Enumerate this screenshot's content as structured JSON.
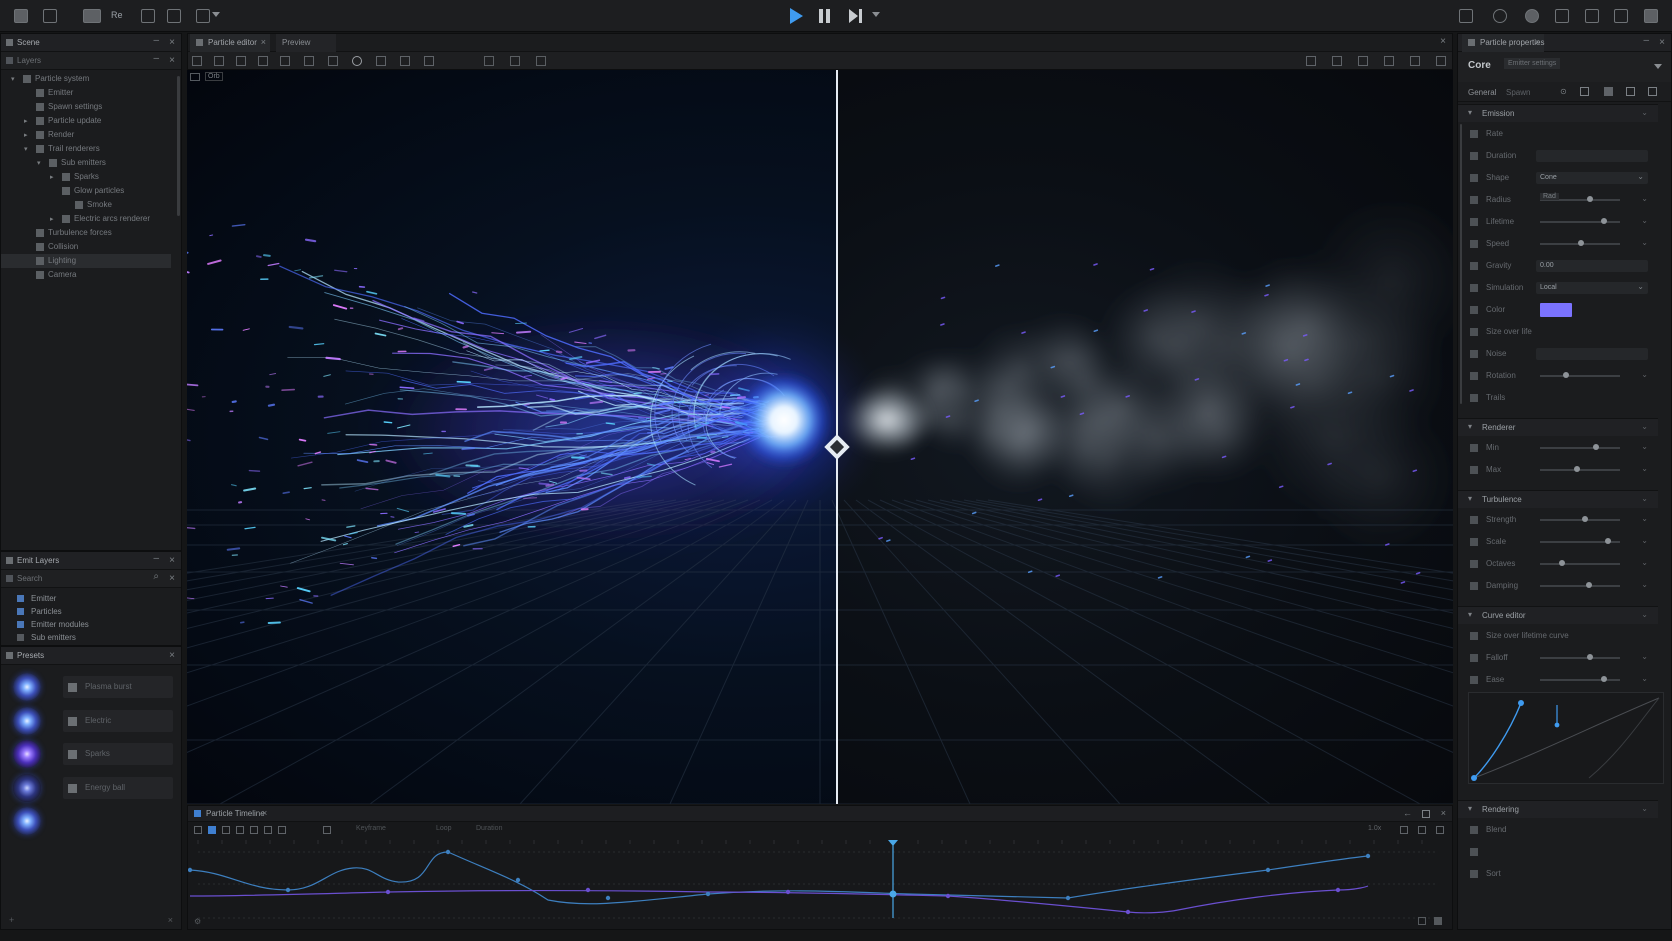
{
  "toolbar": {
    "label": "Re",
    "playback": {
      "play": "play",
      "pause": "pause",
      "step": "step-forward"
    }
  },
  "outliner": {
    "tabs": [
      "Scene",
      ""
    ],
    "filter": "Layers",
    "items": [
      {
        "label": "Particle system",
        "level": 0,
        "expanded": true
      },
      {
        "label": "Emitter",
        "level": 1
      },
      {
        "label": "Spawn settings",
        "level": 1
      },
      {
        "label": "Particle update",
        "level": 1,
        "expanded": false
      },
      {
        "label": "Render",
        "level": 1,
        "expanded": false
      },
      {
        "label": "Trail renderers",
        "level": 1,
        "expanded": true
      },
      {
        "label": "Sub emitters",
        "level": 2,
        "expanded": true
      },
      {
        "label": "Sparks",
        "level": 3,
        "expanded": false
      },
      {
        "label": "Glow particles",
        "level": 3
      },
      {
        "label": "Smoke",
        "level": 4
      },
      {
        "label": "Electric arcs renderer",
        "level": 3,
        "expanded": false
      },
      {
        "label": "Turbulence forces",
        "level": 1
      },
      {
        "label": "Collision",
        "level": 1
      },
      {
        "label": "Lighting",
        "level": 1,
        "selected": true
      },
      {
        "label": "Camera",
        "level": 1
      }
    ]
  },
  "layers": {
    "title": "Emit Layers",
    "filter": "Search",
    "items": [
      "Emitter",
      "Particles",
      "Emitter modules",
      "Sub emitters"
    ]
  },
  "presets": {
    "title": "Presets",
    "items": [
      "Plasma burst",
      "Electric",
      "Sparks",
      "Energy ball",
      ""
    ]
  },
  "viewport": {
    "tabs": [
      "Particle editor",
      "Preview"
    ],
    "overlay_label": "Orb"
  },
  "inspector": {
    "tab": "Particle properties",
    "header": {
      "title": "Core",
      "subtitle": "Emitter settings"
    },
    "subtabs": [
      "General",
      "Spawn"
    ],
    "sections": [
      {
        "title": "Emission",
        "rows": [
          {
            "label": "Rate",
            "kind": "plain"
          },
          {
            "label": "Duration",
            "kind": "field",
            "value": ""
          },
          {
            "label": "Shape",
            "kind": "dropdown",
            "value": "Cone"
          },
          {
            "label": "Radius",
            "kind": "slider",
            "value": "Rad"
          },
          {
            "label": "Lifetime",
            "kind": "slider",
            "value": ""
          },
          {
            "label": "Speed",
            "kind": "slider",
            "value": ""
          },
          {
            "label": "Gravity",
            "kind": "field",
            "value": "0.00"
          },
          {
            "label": "Simulation",
            "kind": "dropdown",
            "value": "Local"
          },
          {
            "label": "Color",
            "kind": "color",
            "value": "#7b73ff"
          },
          {
            "label": "Size over life",
            "kind": "plain"
          },
          {
            "label": "Noise",
            "kind": "field",
            "value": ""
          },
          {
            "label": "Rotation",
            "kind": "slider",
            "value": ""
          },
          {
            "label": "Trails",
            "kind": "plain"
          }
        ]
      },
      {
        "title": "Renderer",
        "rows": [
          {
            "label": "Min",
            "kind": "slider"
          },
          {
            "label": "Max",
            "kind": "slider"
          }
        ]
      },
      {
        "title": "Turbulence",
        "rows": [
          {
            "label": "Strength",
            "kind": "slider"
          },
          {
            "label": "Scale",
            "kind": "slider"
          },
          {
            "label": "Octaves",
            "kind": "slider"
          },
          {
            "label": "Damping",
            "kind": "slider"
          }
        ]
      },
      {
        "title": "Curve editor",
        "rows": [
          {
            "label": "Size over lifetime curve",
            "kind": "plain"
          },
          {
            "label": "Falloff",
            "kind": "slider"
          },
          {
            "label": "Ease",
            "kind": "slider"
          }
        ]
      },
      {
        "title": "Rendering",
        "rows": [
          {
            "label": "Blend",
            "kind": "plain"
          },
          {
            "label": "",
            "kind": "plain"
          },
          {
            "label": "Sort",
            "kind": "plain"
          }
        ]
      }
    ]
  },
  "timeline": {
    "title": "Particle Timeline",
    "toolbar_items": [
      "Keyframe",
      "",
      "Loop",
      "Duration"
    ],
    "zoom": "1.0x"
  },
  "colors": {
    "accent": "#3f9bf0",
    "bg": "#151617",
    "panel": "#1b1c1e",
    "orb_core": "#e8f4ff",
    "orb_blue": "#2f6dff",
    "orb_violet": "#7b4dff",
    "smoke": "#8f969e"
  },
  "icons": [
    "gear-icon",
    "camera-icon",
    "play-icon",
    "pause-icon",
    "step-forward-icon",
    "close-icon",
    "chevron-down-icon"
  ]
}
